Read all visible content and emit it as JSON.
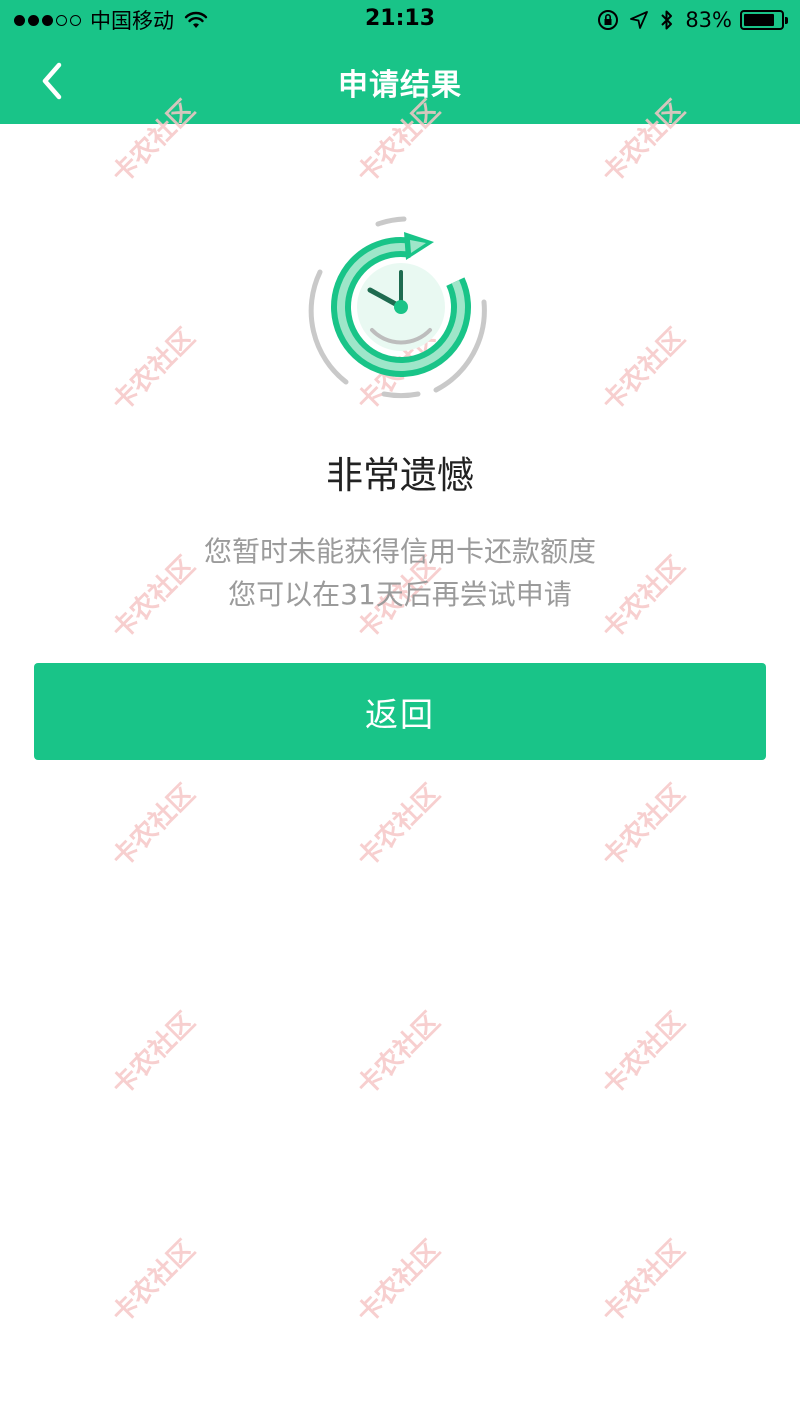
{
  "status_bar": {
    "carrier": "中国移动",
    "time": "21:13",
    "battery_percent_label": "83%",
    "battery_level": 0.83,
    "signal_bars_filled": 3,
    "signal_bars_total": 5
  },
  "nav": {
    "title": "申请结果",
    "back_icon": "chevron-left-icon"
  },
  "result": {
    "icon": "clock-refresh-icon",
    "title": "非常遗憾",
    "message_line1": "您暂时未能获得信用卡还款额度",
    "message_line2": "您可以在31天后再尝试申请"
  },
  "actions": {
    "back_label": "返回"
  },
  "watermark": {
    "text": "卡农社区"
  },
  "colors": {
    "brand_green": "#19c488",
    "title_text": "#222222",
    "secondary_text": "#9b9b9b",
    "watermark": "#f6c7c7"
  }
}
